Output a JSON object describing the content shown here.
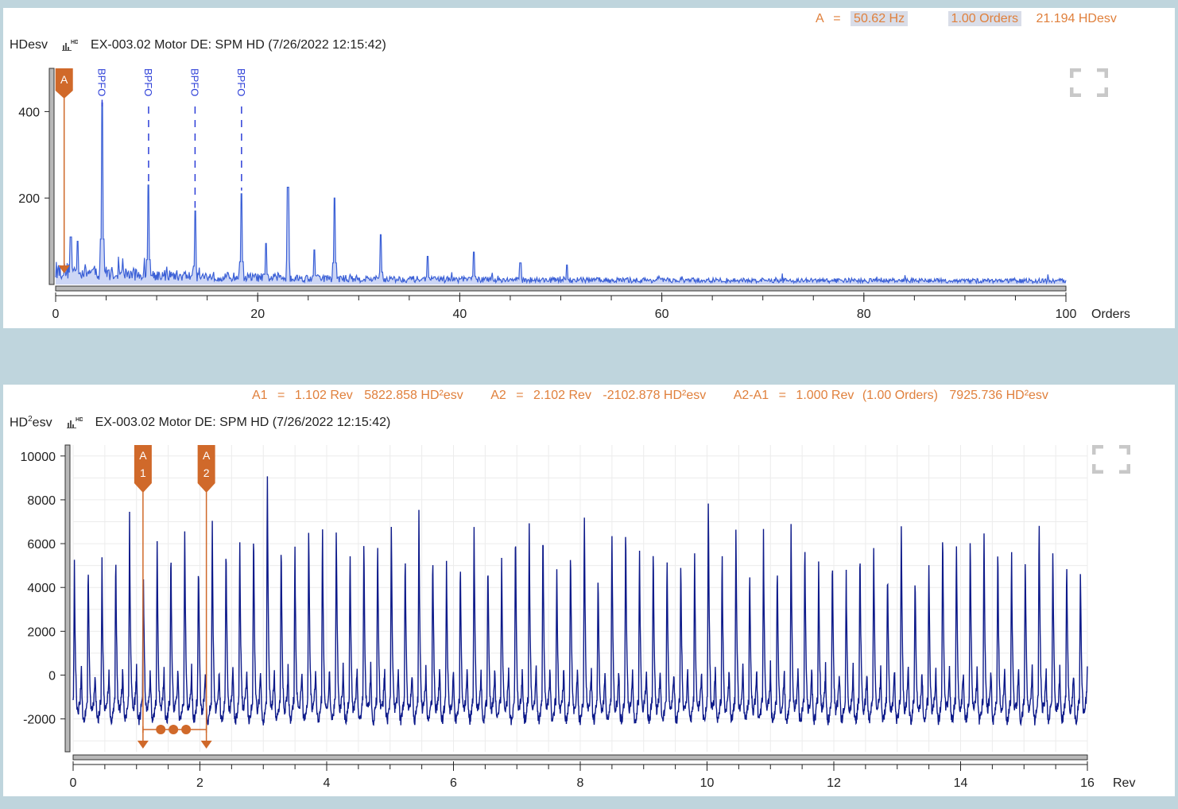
{
  "top": {
    "unit_label": "HDesv",
    "title": "EX-003.02  Motor DE: SPM HD (7/26/2022 12:15:42)",
    "icon": "chart-hd-icon",
    "readout": {
      "cursor": "A",
      "eq": "=",
      "freq": "50.62 Hz",
      "orders": "1.00 Orders",
      "value": "21.194 HDesv"
    },
    "marker_label": "A",
    "fault_labels": [
      "BPFO",
      "BPFO",
      "BPFO",
      "BPFO"
    ],
    "x_unit": "Orders"
  },
  "bottom": {
    "unit_prefix": "HD",
    "unit_sup": "2",
    "unit_suffix": "esv",
    "title": "EX-003.02  Motor DE: SPM HD (7/26/2022 12:15:42)",
    "icon": "chart-hd-icon",
    "readout": {
      "a1_label": "A1",
      "a1_eq": "=",
      "a1_rev": "1.102 Rev",
      "a1_val": "5822.858 HD²esv",
      "a2_label": "A2",
      "a2_eq": "=",
      "a2_rev": "2.102 Rev",
      "a2_val": "-2102.878 HD²esv",
      "diff_label": "A2-A1",
      "diff_eq": "=",
      "diff_rev": "1.000 Rev",
      "diff_orders": "(1.00 Orders)",
      "diff_val": "7925.736 HD²esv"
    },
    "marker_a1": [
      "A",
      "1"
    ],
    "marker_a2": [
      "A",
      "2"
    ],
    "x_unit": "Rev"
  },
  "colors": {
    "spectrum_line": "#3a5fd6",
    "spectrum_fill": "#cdd6f5",
    "waveform_line": "#0d1a8a",
    "cursor": "#d0692a",
    "fault_marker": "#2d3fd8",
    "readout_text": "#e0803c"
  },
  "chart_data": [
    {
      "type": "line",
      "name": "spectrum",
      "xlim": [
        0,
        100
      ],
      "ylim": [
        0,
        500
      ],
      "x_ticks": [
        0,
        20,
        40,
        60,
        80,
        100
      ],
      "x_tick_labels": [
        "0",
        "20",
        "40",
        "60",
        "80",
        "100"
      ],
      "y_ticks": [
        200,
        400
      ],
      "y_tick_labels": [
        "200",
        "400"
      ],
      "xlabel": "Orders",
      "ylabel": "HDesv",
      "grid": false,
      "cursor_x": 1.0,
      "peaks": {
        "x": [
          1.5,
          2.2,
          4.6,
          9.2,
          13.8,
          18.4,
          20.8,
          23.0,
          25.6,
          27.6,
          32.2,
          36.8,
          41.4,
          46.0,
          50.6
        ],
        "y": [
          110,
          100,
          420,
          230,
          170,
          210,
          95,
          225,
          80,
          200,
          115,
          65,
          75,
          50,
          45
        ]
      },
      "fault_markers": {
        "label": "BPFO",
        "x": [
          4.6,
          9.2,
          13.8,
          18.4
        ]
      }
    },
    {
      "type": "line",
      "name": "waveform",
      "xlim": [
        0,
        16
      ],
      "ylim": [
        -3500,
        10500
      ],
      "x_ticks": [
        0,
        2,
        4,
        6,
        8,
        10,
        12,
        14,
        16
      ],
      "x_tick_labels": [
        "0",
        "2",
        "4",
        "6",
        "8",
        "10",
        "12",
        "14",
        "16"
      ],
      "y_ticks": [
        -2000,
        0,
        2000,
        4000,
        6000,
        8000,
        10000
      ],
      "y_tick_labels": [
        "-2000",
        "0",
        "2000",
        "4000",
        "6000",
        "8000",
        "10000"
      ],
      "xlabel": "Rev",
      "ylabel": "HD²esv",
      "grid": true,
      "cursor_a1": 1.102,
      "cursor_a2": 2.102,
      "impact_period_rev": 0.2174,
      "notable_peaks": {
        "x": [
          3.07,
          10.1,
          8.15,
          15.2,
          5.45
        ],
        "y": [
          9400,
          8100,
          7400,
          7300,
          7100
        ]
      }
    }
  ]
}
